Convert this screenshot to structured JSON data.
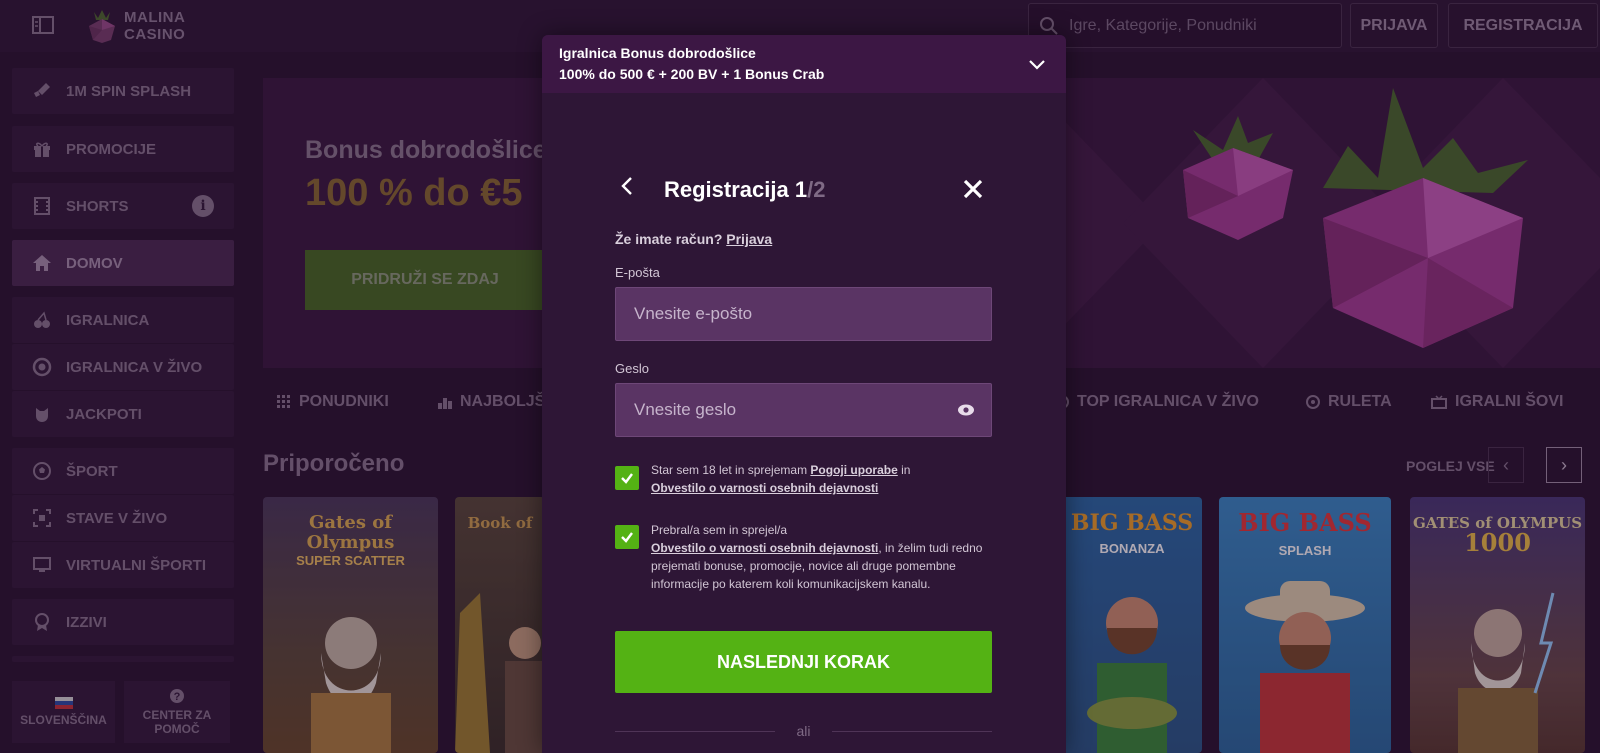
{
  "header": {
    "logo_line1": "MALINA",
    "logo_line2": "CASINO",
    "search_placeholder": "Igre, Kategorije, Ponudniki",
    "login_label": "PRIJAVA",
    "register_label": "REGISTRACIJA"
  },
  "sidebar": {
    "items": [
      {
        "label": "1M SPIN SPLASH",
        "icon": "rocket-icon"
      },
      {
        "label": "PROMOCIJE",
        "icon": "gift-icon"
      },
      {
        "label": "SHORTS",
        "icon": "film-icon"
      },
      {
        "label": "DOMOV",
        "icon": "home-icon"
      },
      {
        "label": "IGRALNICA",
        "icon": "cherries-icon"
      },
      {
        "label": "IGRALNICA V ŽIVO",
        "icon": "chip-icon"
      },
      {
        "label": "JACKPOTI",
        "icon": "pig-icon"
      },
      {
        "label": "ŠPORT",
        "icon": "football-icon"
      },
      {
        "label": "STAVE V ŽIVO",
        "icon": "live-icon"
      },
      {
        "label": "VIRTUALNI ŠPORTI",
        "icon": "monitor-icon"
      },
      {
        "label": "IZZIVI",
        "icon": "badge-icon"
      }
    ],
    "language_label": "SLOVENŠČINA",
    "help_label": "CENTER ZA POMOČ"
  },
  "hero": {
    "title": "Bonus dobrodošlice",
    "amount": "100 % do €5",
    "cta": "PRIDRUŽI SE ZDAJ"
  },
  "categories": [
    {
      "label": "PONUDNIKI",
      "icon": "grid-icon"
    },
    {
      "label": "NAJBOLJŠ",
      "icon": "podium-icon"
    },
    {
      "label": "TOP IGRALNICA V ŽIVO",
      "icon": "chip-icon"
    },
    {
      "label": "RULETA",
      "icon": "roulette-icon"
    },
    {
      "label": "IGRALNI ŠOVI",
      "icon": "tv-icon"
    }
  ],
  "recommended": {
    "title": "Priporočeno",
    "view_all": "POGLEJ VSE",
    "games": [
      {
        "title": "Gates of Olympus",
        "subtitle": "SUPER SCATTER"
      },
      {
        "title": "Book of",
        "subtitle": ""
      },
      {
        "title": "BIG BASS",
        "subtitle": "BONANZA"
      },
      {
        "title": "BIG BASS",
        "subtitle": "SPLASH"
      },
      {
        "title": "GATES of OLYMPUS",
        "subtitle": "1000"
      }
    ]
  },
  "modal": {
    "bonus_line1": "Igralnica Bonus dobrodošlice",
    "bonus_line2": "100% do 500 € + 200 BV + 1 Bonus Crab",
    "title": "Registracija 1",
    "step_suffix": "/2",
    "have_account": "Že imate račun?",
    "login_link": "Prijava",
    "email_label": "E-pošta",
    "email_placeholder": "Vnesite e-pošto",
    "password_label": "Geslo",
    "password_placeholder": "Vnesite geslo",
    "consent1_prefix": "Star sem 18 let in sprejemam",
    "consent1_link1": "Pogoji uporabe",
    "consent1_mid": "in",
    "consent1_link2": "Obvestilo o varnosti osebnih dejavnosti",
    "consent2_prefix": "Prebral/a sem in sprejel/a",
    "consent2_link": "Obvestilo o varnosti osebnih dejavnosti",
    "consent2_suffix": ", in želim tudi redno prejemati bonuse, promocije, novice ali druge pomembne informacije po katerem koli komunikacijskem kanalu.",
    "next_button": "NASLEDNJI KORAK",
    "divider_text": "ali"
  },
  "colors": {
    "accent_green": "#54b214",
    "modal_bg": "#2e1636",
    "modal_header_bg": "#3c1744",
    "input_bg": "#5a3464"
  }
}
